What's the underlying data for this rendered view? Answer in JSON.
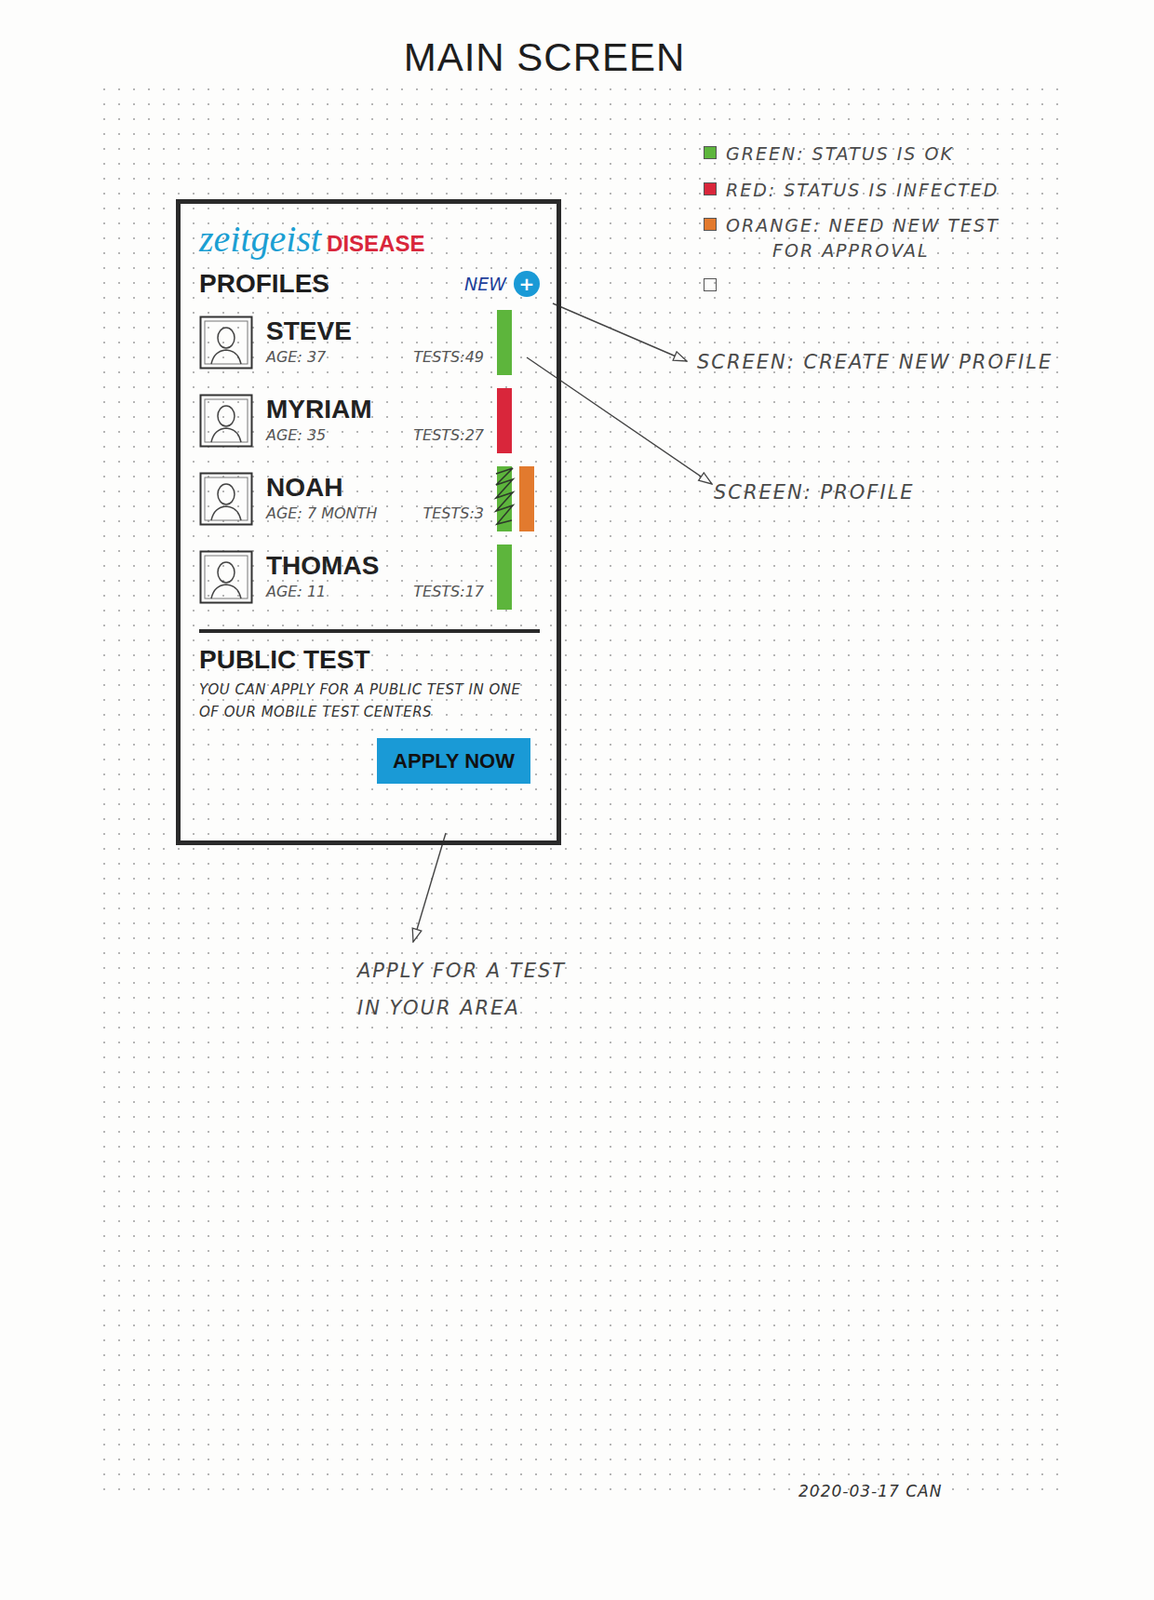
{
  "title": "MAIN SCREEN",
  "legend": [
    {
      "kind": "swatch",
      "color": "#5db53c",
      "lines": [
        "GREEN: STATUS IS OK"
      ]
    },
    {
      "kind": "swatch",
      "color": "#d9263b",
      "lines": [
        "RED: STATUS IS INFECTED"
      ]
    },
    {
      "kind": "swatch",
      "color": "#e27a2e",
      "lines": [
        "ORANGE: NEED NEW TEST",
        "FOR APPROVAL"
      ]
    },
    {
      "kind": "blank",
      "lines": []
    }
  ],
  "app": {
    "logo": "zeitgeist",
    "logo_tag": "DISEASE",
    "profiles_title": "PROFILES",
    "new_label": "NEW",
    "new_icon": "+",
    "profiles": [
      {
        "name": "STEVE",
        "age": "AGE: 37",
        "tests": "TESTS:49",
        "statuses": [
          {
            "color": "#5db53c",
            "crossed": false
          }
        ]
      },
      {
        "name": "MYRIAM",
        "age": "AGE: 35",
        "tests": "TESTS:27",
        "statuses": [
          {
            "color": "#d9263b",
            "crossed": false
          }
        ]
      },
      {
        "name": "NOAH",
        "age": "AGE: 7 MONTH",
        "tests": "TESTS:3",
        "statuses": [
          {
            "color": "#5db53c",
            "crossed": true
          },
          {
            "color": "#e27a2e",
            "crossed": false
          }
        ]
      },
      {
        "name": "THOMAS",
        "age": "AGE: 11",
        "tests": "TESTS:17",
        "statuses": [
          {
            "color": "#5db53c",
            "crossed": false
          }
        ]
      }
    ],
    "public_test": {
      "title": "PUBLIC TEST",
      "text": "YOU CAN APPLY FOR A PUBLIC TEST IN ONE OF OUR MOBILE TEST CENTERS",
      "button": "APPLY NOW"
    }
  },
  "annotations": [
    {
      "lines": [
        "SCREEN: CREATE NEW PROFILE"
      ]
    },
    {
      "lines": [
        "SCREEN: PROFILE"
      ]
    },
    {
      "lines": [
        "APPLY FOR A TEST",
        "IN YOUR AREA"
      ]
    }
  ],
  "footer": "2020-03-17 CAN"
}
